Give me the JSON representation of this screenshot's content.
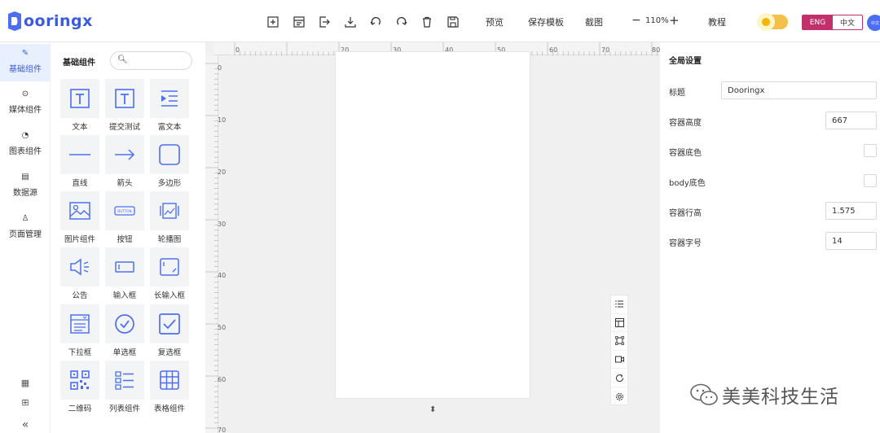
{
  "app": {
    "name": "Dooringx",
    "logo_letters": "ooringx"
  },
  "toolbar": {
    "icons": [
      "new-icon",
      "template-icon",
      "import-icon",
      "download-icon",
      "undo-icon",
      "redo-icon",
      "delete-icon",
      "save-icon"
    ],
    "preview": "预览",
    "save_template": "保存模板",
    "screenshot": "截图",
    "zoom_minus": "−",
    "zoom": "110%",
    "zoom_plus": "+",
    "tutorial": "教程",
    "lang_en": "ENG",
    "lang_zh": "中文"
  },
  "leftnav": {
    "items": [
      {
        "label": "基础组件",
        "icon": "pencil-icon"
      },
      {
        "label": "媒体组件",
        "icon": "play-icon"
      },
      {
        "label": "图表组件",
        "icon": "pie-chart-icon"
      },
      {
        "label": "数据源",
        "icon": "document-icon"
      },
      {
        "label": "页面管理",
        "icon": "user-icon"
      }
    ],
    "bottom": [
      "qr-icon",
      "grid-icon",
      "collapse-icon"
    ]
  },
  "panel": {
    "title": "基础组件",
    "components": [
      {
        "label": "文本",
        "icon": "text-icon"
      },
      {
        "label": "提交测试",
        "icon": "text-icon"
      },
      {
        "label": "富文本",
        "icon": "rich-text-icon"
      },
      {
        "label": "直线",
        "icon": "line-icon"
      },
      {
        "label": "箭头",
        "icon": "arrow-icon"
      },
      {
        "label": "多边形",
        "icon": "rectangle-icon"
      },
      {
        "label": "图片组件",
        "icon": "image-icon"
      },
      {
        "label": "按钮",
        "icon": "button-icon"
      },
      {
        "label": "轮播图",
        "icon": "carousel-icon"
      },
      {
        "label": "公告",
        "icon": "speaker-icon"
      },
      {
        "label": "输入框",
        "icon": "input-icon"
      },
      {
        "label": "长输入框",
        "icon": "textarea-icon"
      },
      {
        "label": "下拉框",
        "icon": "select-icon"
      },
      {
        "label": "单选框",
        "icon": "radio-icon"
      },
      {
        "label": "复选框",
        "icon": "checkbox-icon"
      },
      {
        "label": "二维码",
        "icon": "qrcode-icon"
      },
      {
        "label": "列表组件",
        "icon": "list-icon"
      },
      {
        "label": "表格组件",
        "icon": "table-icon"
      }
    ],
    "button_text": "BUTTON"
  },
  "canvas": {
    "ruler_top": [
      "0",
      "20",
      "30",
      "40",
      "50",
      "60",
      "70",
      "80"
    ],
    "ruler_left": [
      "0",
      "10",
      "20",
      "30",
      "40",
      "50",
      "60",
      "70"
    ],
    "side_tools": [
      "list-icon",
      "layout-icon",
      "crop-icon",
      "video-icon",
      "refresh-icon",
      "settings-icon"
    ]
  },
  "settings": {
    "title": "全局设置",
    "fields": [
      {
        "label": "标题",
        "value": "Dooringx"
      },
      {
        "label": "容器高度",
        "value": "667"
      },
      {
        "label": "容器底色",
        "value": ""
      },
      {
        "label": "body底色",
        "value": ""
      },
      {
        "label": "容器行高",
        "value": "1.575"
      },
      {
        "label": "容器字号",
        "value": "14"
      }
    ]
  },
  "watermark": "美美科技生活",
  "avatar_text": "中文"
}
